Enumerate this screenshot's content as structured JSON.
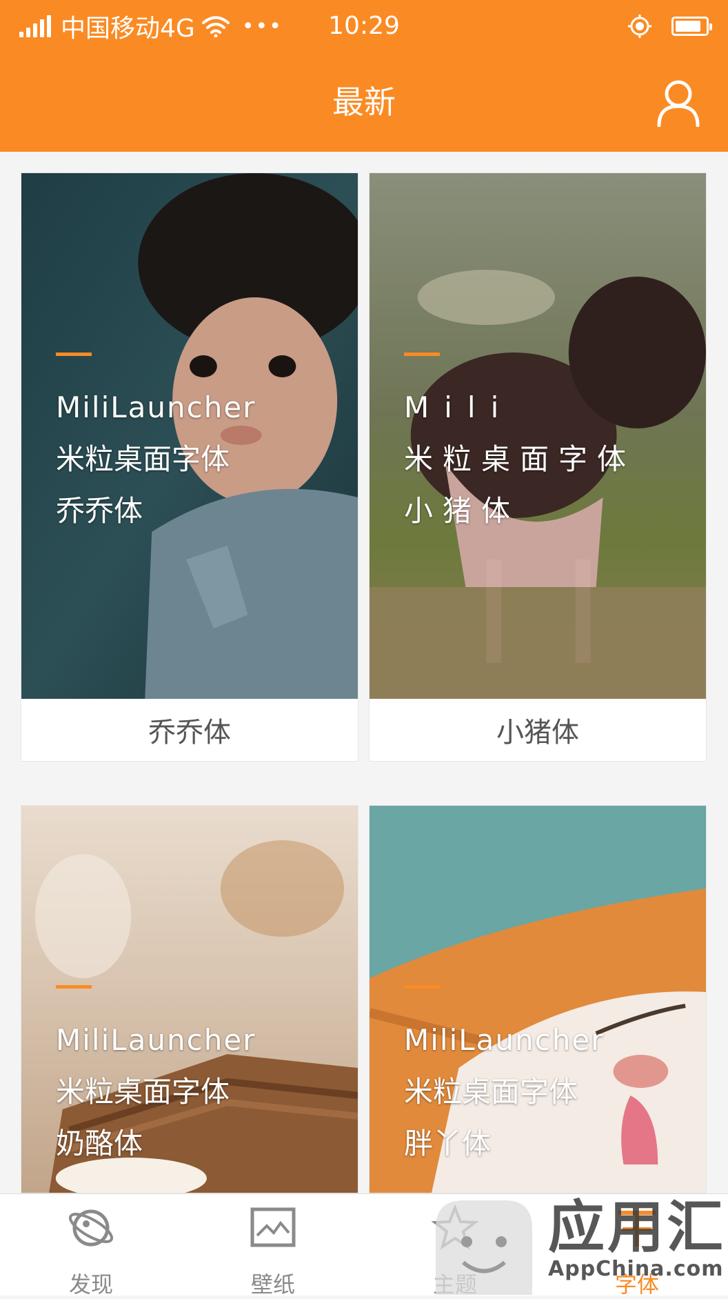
{
  "status_bar": {
    "carrier": "中国移动4G",
    "time": "10:29",
    "more": "•••",
    "battery_level": 0.85
  },
  "nav": {
    "title": "最新",
    "profile_icon": "user-icon"
  },
  "cards": [
    {
      "sample_latin": "MiliLauncher",
      "sample_line2": "米粒桌面字体",
      "sample_line3": "乔乔体",
      "caption": "乔乔体"
    },
    {
      "sample_latin": "Mili",
      "sample_line2": "米粒桌面字体",
      "sample_line3": "小猪体",
      "caption": "小猪体"
    },
    {
      "sample_latin": "MiliLauncher",
      "sample_line2": "米粒桌面字体",
      "sample_line3": "奶酪体",
      "caption": ""
    },
    {
      "sample_latin": "MiliLauncher",
      "sample_line2": "米粒桌面字体",
      "sample_line3": "胖丫体",
      "caption": ""
    }
  ],
  "tabs": [
    {
      "label": "发现",
      "icon": "planet-icon"
    },
    {
      "label": "壁纸",
      "icon": "image-icon"
    },
    {
      "label": "主题",
      "icon": "star-icon"
    },
    {
      "label": "字体",
      "icon": "font-icon"
    }
  ],
  "watermark": {
    "text": "应用汇",
    "sub": "AppChina.com"
  },
  "colors": {
    "accent": "#fa8b24",
    "tab_inactive": "#8a8a8a"
  }
}
